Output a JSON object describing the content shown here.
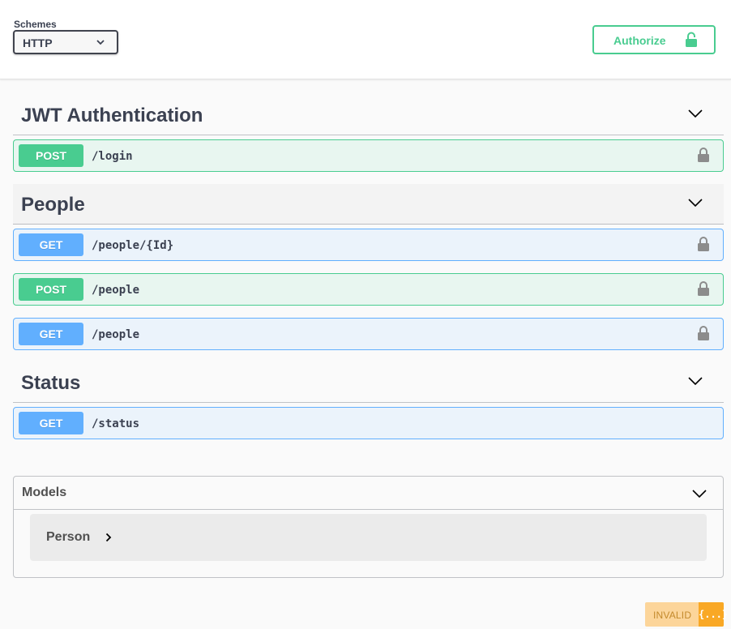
{
  "schemes": {
    "label": "Schemes",
    "selected": "HTTP"
  },
  "authorize": {
    "label": "Authorize"
  },
  "tags": [
    {
      "name": "JWT Authentication",
      "operations": [
        {
          "method": "POST",
          "path": "/login"
        }
      ]
    },
    {
      "name": "People",
      "operations": [
        {
          "method": "GET",
          "path": "/people/{Id}"
        },
        {
          "method": "POST",
          "path": "/people"
        },
        {
          "method": "GET",
          "path": "/people"
        }
      ]
    },
    {
      "name": "Status",
      "operations": [
        {
          "method": "GET",
          "path": "/status"
        }
      ]
    }
  ],
  "models": {
    "title": "Models",
    "items": [
      {
        "name": "Person"
      }
    ]
  },
  "validator": {
    "status": "INVALID",
    "icon_text": "{...}"
  },
  "colors": {
    "post": "#49cc90",
    "get": "#61affe",
    "text": "#3b4151",
    "validator": "#f9a825"
  },
  "icons": {
    "lock": "lock-icon",
    "chevron": "chevron-down-icon",
    "arrow": "chevron-right-icon"
  }
}
